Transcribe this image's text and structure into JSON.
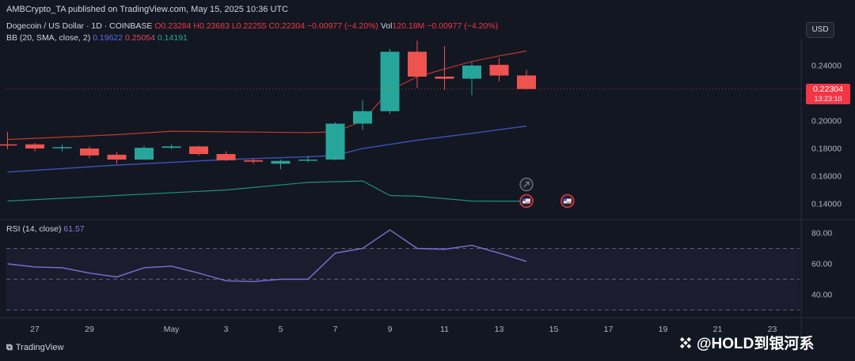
{
  "header": {
    "published": "AMBCrypto_TA published on TradingView.com, May 15, 2025 10:36 UTC"
  },
  "legend": {
    "symbol": "Dogecoin / US Dollar · 1D · COINBASE",
    "ohlc": "O0.23284 H0.23683 L0.22255 C0.22304",
    "change": "−0.00977 (−4.20%)",
    "vol_label": "Vol",
    "vol_value": "120.18M",
    "vol_change": "−0.00977 (−4.20%)",
    "bb_label": "BB (20, SMA, close, 2)",
    "bb_basis": "0.19622",
    "bb_upper": "0.25054",
    "bb_lower": "0.14191",
    "rsi_label": "RSI (14, close)",
    "rsi_value": "61.57"
  },
  "currency_button": "USD",
  "last_price": {
    "price": "0.22304",
    "countdown": "13:23:10"
  },
  "footer": {
    "brand": "TradingView"
  },
  "watermark": "@HOLD到银河系",
  "colors": {
    "up": "#26a69a",
    "down": "#ef5350",
    "bb_basis": "#3f51b5",
    "bb_upper": "#c0392b",
    "bb_lower": "#1f8f7a",
    "rsi": "#7e6fd1",
    "background": "#131722"
  },
  "chart_data": [
    {
      "type": "candlestick",
      "title": "Dogecoin / US Dollar · 1D · COINBASE",
      "x_ticks": [
        "27",
        "29",
        "May",
        "3",
        "5",
        "7",
        "9",
        "11",
        "13",
        "15",
        "17",
        "19",
        "21",
        "23"
      ],
      "x_tick_days": [
        -4,
        -2,
        1,
        3,
        5,
        7,
        9,
        11,
        13,
        15,
        17,
        19,
        21,
        23
      ],
      "y_ticks": [
        "0.14000",
        "0.16000",
        "0.18000",
        "0.20000",
        "0.22000",
        "0.24000"
      ],
      "ylim": [
        0.13,
        0.26
      ],
      "candles": [
        {
          "day": -5,
          "o": 0.183,
          "h": 0.192,
          "l": 0.1795,
          "c": 0.1825
        },
        {
          "day": -4,
          "o": 0.183,
          "h": 0.184,
          "l": 0.178,
          "c": 0.18
        },
        {
          "day": -3,
          "o": 0.1805,
          "h": 0.183,
          "l": 0.178,
          "c": 0.181
        },
        {
          "day": -2,
          "o": 0.18,
          "h": 0.1815,
          "l": 0.173,
          "c": 0.175
        },
        {
          "day": -1,
          "o": 0.1755,
          "h": 0.1775,
          "l": 0.169,
          "c": 0.172
        },
        {
          "day": 0,
          "o": 0.172,
          "h": 0.182,
          "l": 0.1715,
          "c": 0.1805
        },
        {
          "day": 1,
          "o": 0.1805,
          "h": 0.183,
          "l": 0.1795,
          "c": 0.1815
        },
        {
          "day": 2,
          "o": 0.1815,
          "h": 0.182,
          "l": 0.175,
          "c": 0.176
        },
        {
          "day": 3,
          "o": 0.176,
          "h": 0.178,
          "l": 0.171,
          "c": 0.1715
        },
        {
          "day": 4,
          "o": 0.1715,
          "h": 0.1725,
          "l": 0.169,
          "c": 0.1705
        },
        {
          "day": 5,
          "o": 0.169,
          "h": 0.172,
          "l": 0.165,
          "c": 0.171
        },
        {
          "day": 6,
          "o": 0.1715,
          "h": 0.1745,
          "l": 0.17,
          "c": 0.172
        },
        {
          "day": 7,
          "o": 0.172,
          "h": 0.199,
          "l": 0.1715,
          "c": 0.198
        },
        {
          "day": 8,
          "o": 0.198,
          "h": 0.215,
          "l": 0.1935,
          "c": 0.207
        },
        {
          "day": 9,
          "o": 0.207,
          "h": 0.252,
          "l": 0.205,
          "c": 0.25
        },
        {
          "day": 10,
          "o": 0.25,
          "h": 0.258,
          "l": 0.224,
          "c": 0.232
        },
        {
          "day": 11,
          "o": 0.232,
          "h": 0.254,
          "l": 0.2225,
          "c": 0.2305
        },
        {
          "day": 12,
          "o": 0.2305,
          "h": 0.2425,
          "l": 0.2185,
          "c": 0.24
        },
        {
          "day": 13,
          "o": 0.2405,
          "h": 0.2455,
          "l": 0.2285,
          "c": 0.2328
        },
        {
          "day": 14,
          "o": 0.23284,
          "h": 0.23683,
          "l": 0.22255,
          "c": 0.22304
        }
      ],
      "bb_basis": [
        {
          "day": -5,
          "v": 0.163
        },
        {
          "day": -1,
          "v": 0.168
        },
        {
          "day": 3,
          "v": 0.172
        },
        {
          "day": 6,
          "v": 0.174
        },
        {
          "day": 7,
          "v": 0.175
        },
        {
          "day": 8,
          "v": 0.18
        },
        {
          "day": 10,
          "v": 0.186
        },
        {
          "day": 12,
          "v": 0.191
        },
        {
          "day": 14,
          "v": 0.19622
        }
      ],
      "bb_upper": [
        {
          "day": -5,
          "v": 0.1865
        },
        {
          "day": -1,
          "v": 0.19
        },
        {
          "day": 1,
          "v": 0.1925
        },
        {
          "day": 6,
          "v": 0.1915
        },
        {
          "day": 7,
          "v": 0.192
        },
        {
          "day": 8,
          "v": 0.2
        },
        {
          "day": 9,
          "v": 0.222
        },
        {
          "day": 10,
          "v": 0.232
        },
        {
          "day": 12,
          "v": 0.243
        },
        {
          "day": 13,
          "v": 0.247
        },
        {
          "day": 14,
          "v": 0.25054
        }
      ],
      "bb_lower": [
        {
          "day": -5,
          "v": 0.142
        },
        {
          "day": -1,
          "v": 0.146
        },
        {
          "day": 3,
          "v": 0.15
        },
        {
          "day": 6,
          "v": 0.1555
        },
        {
          "day": 8,
          "v": 0.1565
        },
        {
          "day": 9,
          "v": 0.146
        },
        {
          "day": 10,
          "v": 0.1455
        },
        {
          "day": 12,
          "v": 0.142
        },
        {
          "day": 14,
          "v": 0.14191
        }
      ],
      "events": [
        {
          "day": 14,
          "price": 0.154,
          "type": "dividend"
        },
        {
          "day": 14,
          "price": 0.142,
          "type": "economic"
        },
        {
          "day": 15.5,
          "price": 0.142,
          "type": "economic"
        }
      ]
    },
    {
      "type": "line",
      "title": "RSI (14, close)",
      "y_ticks": [
        "40.00",
        "60.00",
        "80.00"
      ],
      "ylim": [
        29,
        85
      ],
      "bands": {
        "upper": 70,
        "middle": 50,
        "lower": 30
      },
      "x": [
        -5,
        -4,
        -3,
        -2,
        -1,
        0,
        1,
        2,
        3,
        4,
        5,
        6,
        7,
        8,
        9,
        10,
        11,
        12,
        13,
        14
      ],
      "values": [
        60,
        58,
        57.5,
        54,
        51.5,
        57.5,
        58.5,
        54,
        49,
        48.5,
        50,
        50,
        67,
        70,
        82,
        70,
        69.5,
        72,
        67,
        61.57
      ]
    }
  ]
}
